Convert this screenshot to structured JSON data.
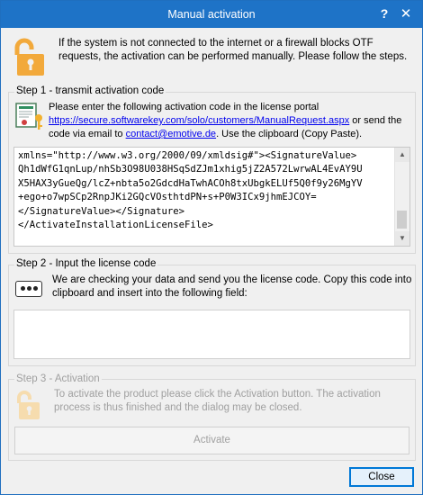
{
  "window": {
    "title": "Manual activation",
    "help_label": "?",
    "close_label": "✕"
  },
  "intro": "If the system is not connected to the internet or a firewall blocks OTF requests, the activation can be performed manually. Please follow the steps.",
  "step1": {
    "legend": "Step 1 - transmit activation code",
    "text_before_link": "Please enter the following activation code in the license portal ",
    "portal_link": "https://secure.softwarekey.com/solo/customers/ManualRequest.aspx",
    "text_after_link": " or send the code via email to ",
    "email_link": "contact@emotive.de",
    "text_end": ". Use the clipboard (Copy  Paste).",
    "code_lines": [
      "xmlns=\"http://www.w3.org/2000/09/xmldsig#\"><SignatureValue>",
      "Qh1dWfG1qnLup/nhSb3O98U038HSqSdZJm1xhig5jZ2A572LwrwAL4EvAY9U",
      "X5HAX3yGueQg/lcZ+nbta5o2GdcdHaTwhACOh8txUbgkELUf5Q0f9y26MgYV",
      "+ego+o7wpSCp2RnpJKi2GQcVOsthtdPN+s+P0W3ICx9jhmEJCOY=",
      "</SignatureValue></Signature>",
      "</ActivateInstallationLicenseFile>"
    ]
  },
  "step2": {
    "legend": "Step 2 - Input the license code",
    "text": "We are checking your data and send you the license code. Copy this code into clipboard and insert into the following field:",
    "input_value": ""
  },
  "step3": {
    "legend": "Step 3 - Activation",
    "text": "To activate the product please click the Activation button. The activation process is thus finished and the dialog may be closed.",
    "activate_label": "Activate"
  },
  "close_button_label": "Close",
  "colors": {
    "titlebar": "#1e73c7",
    "lock_enabled": "#f2a93b",
    "lock_disabled": "#f6dcae",
    "link": "#0000ee"
  }
}
